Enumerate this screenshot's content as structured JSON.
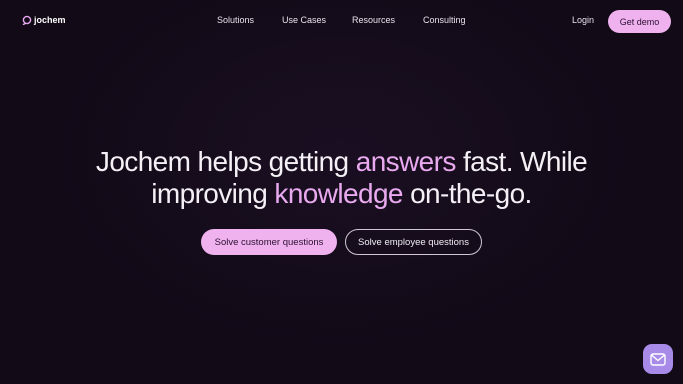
{
  "header": {
    "logo_text": "jochem",
    "nav": [
      {
        "label": "Solutions"
      },
      {
        "label": "Use Cases"
      },
      {
        "label": "Resources"
      },
      {
        "label": "Consulting"
      }
    ],
    "login_label": "Login",
    "demo_label": "Get demo"
  },
  "hero": {
    "line1_a": "Jochem helps getting ",
    "line1_accent": "answers",
    "line1_b": " fast. While",
    "line2_a": "improving ",
    "line2_accent": "knowledge",
    "line2_b": " on-the-go."
  },
  "cta": {
    "primary_label": "Solve customer questions",
    "secondary_label": "Solve employee questions"
  },
  "chat": {
    "icon": "envelope-icon"
  },
  "colors": {
    "background": "#120a17",
    "accent": "#e8a9ee",
    "button": "#f0b2ef",
    "chat_button": "#a88be8"
  }
}
